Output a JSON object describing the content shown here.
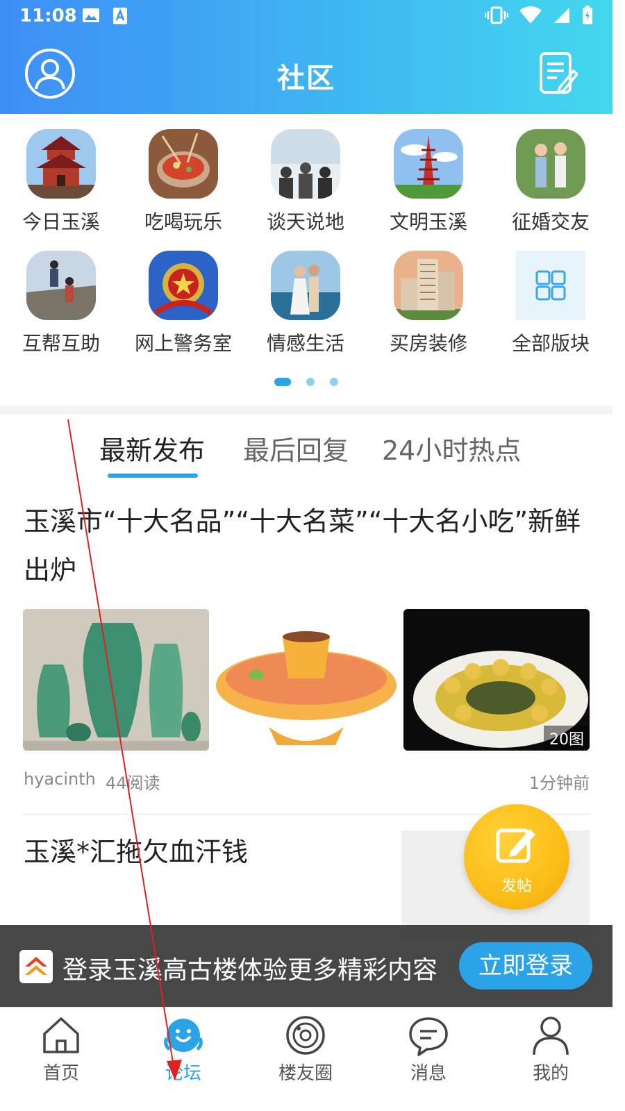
{
  "status_bar": {
    "time": "11:08"
  },
  "header": {
    "title": "社区"
  },
  "forums": [
    {
      "label": "今日玉溪",
      "icon": "pagoda-icon"
    },
    {
      "label": "吃喝玩乐",
      "icon": "hotpot-icon"
    },
    {
      "label": "谈天说地",
      "icon": "meeting-icon"
    },
    {
      "label": "文明玉溪",
      "icon": "tower-icon"
    },
    {
      "label": "征婚交友",
      "icon": "couple-icon"
    },
    {
      "label": "互帮互助",
      "icon": "climb-help-icon"
    },
    {
      "label": "网上警务室",
      "icon": "police-badge-icon"
    },
    {
      "label": "情感生活",
      "icon": "romance-icon"
    },
    {
      "label": "买房装修",
      "icon": "building-icon"
    },
    {
      "label": "全部版块",
      "icon": "grid-icon"
    }
  ],
  "tabs": [
    {
      "label": "最新发布",
      "active": true
    },
    {
      "label": "最后回复",
      "active": false
    },
    {
      "label": "24小时热点",
      "active": false
    }
  ],
  "posts": [
    {
      "title": "玉溪市“十大名品”“十大名菜”“十大名小吃”新鲜出炉",
      "image_badge": "20图",
      "author": "hyacinth",
      "reads": "44阅读",
      "time": "1分钟前"
    },
    {
      "title": "玉溪*汇拖欠血汗钱"
    }
  ],
  "fab": {
    "label": "发帖"
  },
  "login_banner": {
    "text": "登录玉溪高古楼体验更多精彩内容",
    "button": "立即登录"
  },
  "bottom_nav": [
    {
      "label": "首页",
      "icon": "home-icon",
      "active": false
    },
    {
      "label": "论坛",
      "icon": "forum-icon",
      "active": true
    },
    {
      "label": "楼友圈",
      "icon": "planet-icon",
      "active": false
    },
    {
      "label": "消息",
      "icon": "message-icon",
      "active": false
    },
    {
      "label": "我的",
      "icon": "user-icon",
      "active": false
    }
  ],
  "colors": {
    "accent": "#2aa3e8",
    "fab": "#fbbd17",
    "header_start": "#3e8ef5",
    "header_end": "#43d7ee"
  }
}
